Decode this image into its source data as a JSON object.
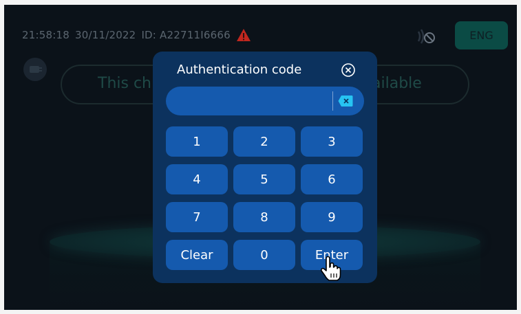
{
  "status_bar": {
    "time": "21:58:18",
    "date": "30/11/2022",
    "id_text": "ID: A22711I6666"
  },
  "language_button": {
    "label": "ENG"
  },
  "banner": {
    "text_left": "This ch",
    "text_right": "ailable"
  },
  "modal": {
    "title": "Authentication code",
    "code_value": "",
    "keys": [
      "1",
      "2",
      "3",
      "4",
      "5",
      "6",
      "7",
      "8",
      "9",
      "Clear",
      "0",
      "Enter"
    ]
  },
  "colors": {
    "modal_bg": "#0c325e",
    "key_bg": "#155aae",
    "warning": "#c0271f",
    "lang_button_bg": "#0b4b45"
  },
  "icons": [
    "warning-icon",
    "no-connection-icon",
    "plug-icon",
    "close-icon",
    "backspace-icon",
    "hand-cursor-icon"
  ]
}
